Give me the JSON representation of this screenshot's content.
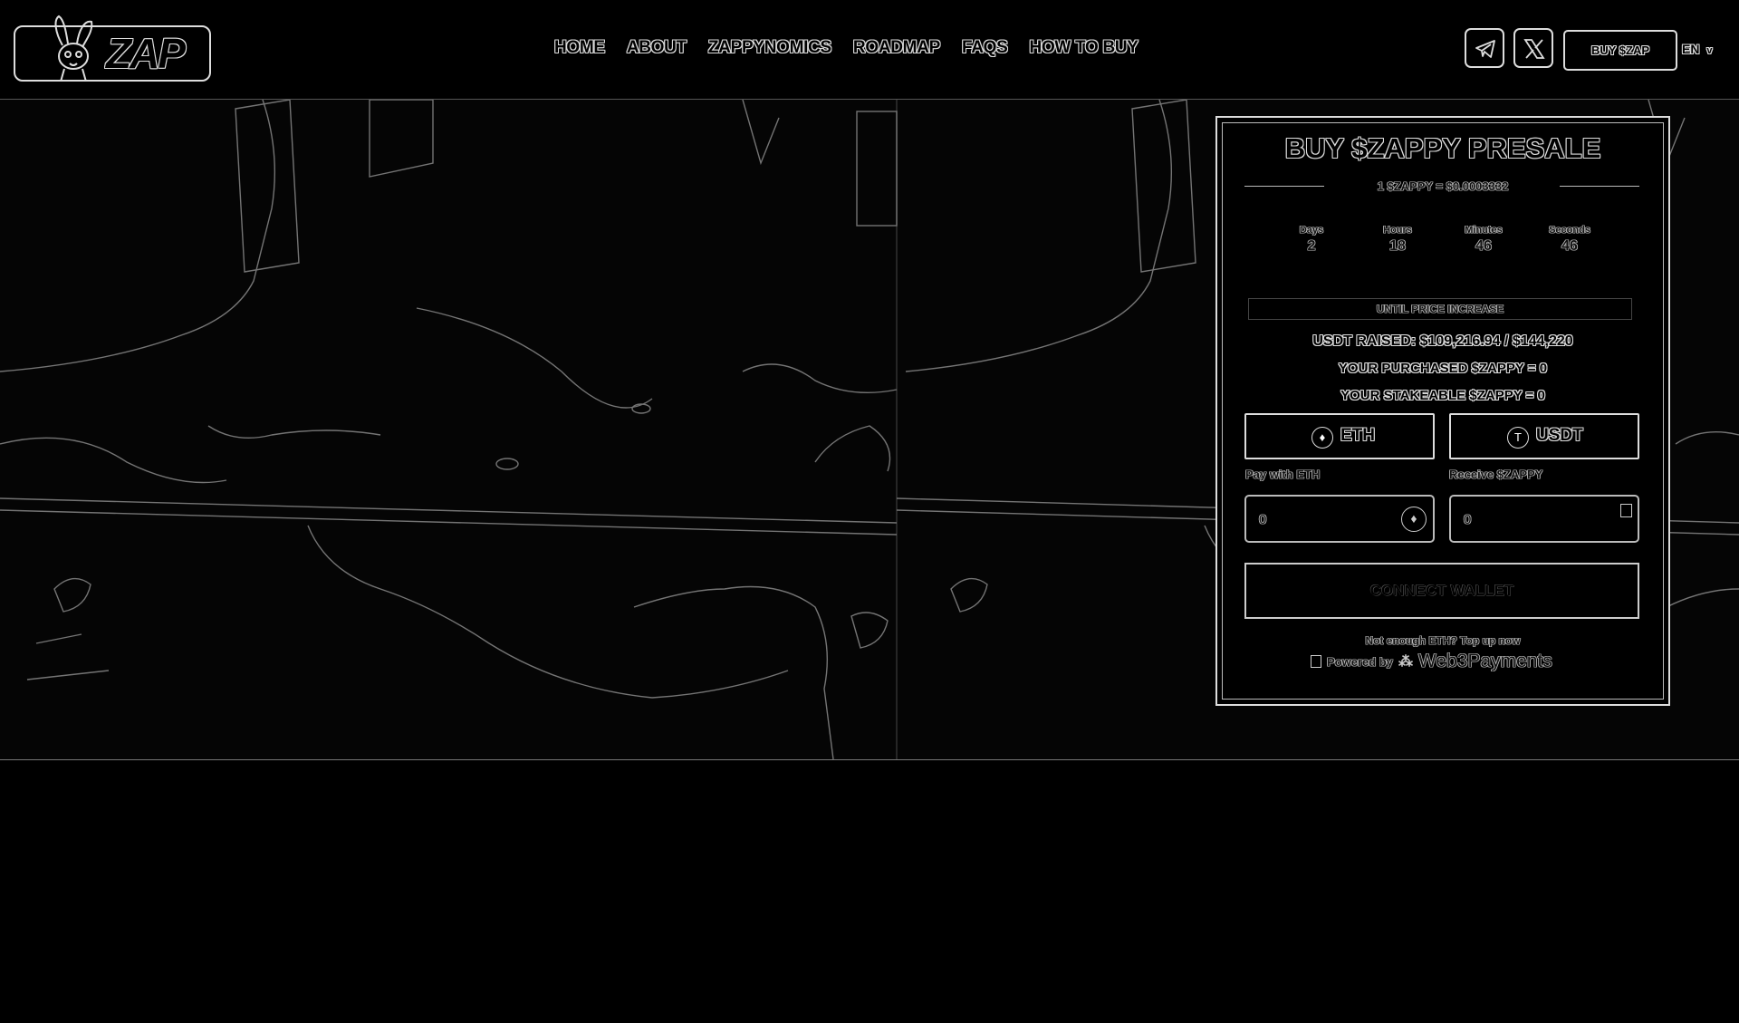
{
  "header": {
    "logo_text": "ZAP",
    "nav": [
      "HOME",
      "ABOUT",
      "ZAPPYNOMICS",
      "ROADMAP",
      "FAQS",
      "HOW TO BUY"
    ],
    "social": [
      "telegram-icon",
      "x-icon"
    ],
    "buy_button": "BUY $ZAP",
    "language": "EN"
  },
  "presale": {
    "title": "BUY $ZAPPY PRESALE",
    "rate": "1 $ZAPPY = $0.0003332",
    "countdown": [
      {
        "label": "Days",
        "value": "2"
      },
      {
        "label": "Hours",
        "value": "18"
      },
      {
        "label": "Minutes",
        "value": "46"
      },
      {
        "label": "Seconds",
        "value": "46"
      }
    ],
    "until_label": "UNTIL PRICE INCREASE",
    "raised": "USDT RAISED: $109,216.94 / $144,220",
    "purchased": "YOUR PURCHASED $ZAPPY = 0",
    "stakeable": "YOUR STAKEABLE $ZAPPY = 0",
    "tabs": [
      {
        "label": "ETH",
        "icon": "eth-icon"
      },
      {
        "label": "USDT",
        "icon": "tether-icon"
      }
    ],
    "pay_label": "Pay with ETH",
    "receive_label": "Receive $ZAPPY",
    "pay_value": "0",
    "receive_value": "0",
    "connect_button": "CONNECT WALLET",
    "topup_text": "Not enough ETH? Top up now",
    "powered_by": "Powered by",
    "powered_brand": "Web3Payments"
  }
}
